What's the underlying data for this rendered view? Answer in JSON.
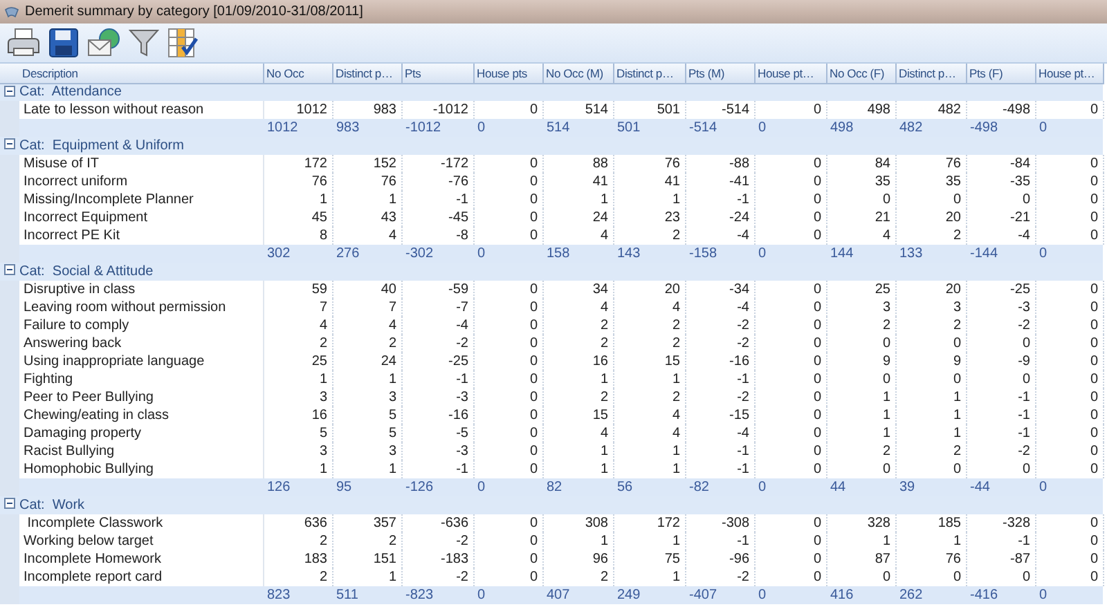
{
  "window": {
    "title": "Demerit summary by category [01/09/2010-31/08/2011]"
  },
  "table": {
    "columns": [
      "Description",
      "No Occ",
      "Distinct p…",
      "Pts",
      "House pts",
      "No Occ (M)",
      "Distinct p…",
      "Pts (M)",
      "House pt…",
      "No Occ (F)",
      "Distinct p…",
      "Pts (F)",
      "House pt…"
    ],
    "groups": [
      {
        "label": "Cat:  Attendance",
        "expanded": true,
        "rows": [
          {
            "description": "Late to lesson without reason",
            "values": [
              "1012",
              "983",
              "-1012",
              "0",
              "514",
              "501",
              "-514",
              "0",
              "498",
              "482",
              "-498",
              "0"
            ]
          }
        ],
        "totals": [
          "1012",
          "983",
          "-1012",
          "0",
          "514",
          "501",
          "-514",
          "0",
          "498",
          "482",
          "-498",
          "0"
        ]
      },
      {
        "label": "Cat:  Equipment & Uniform",
        "expanded": true,
        "rows": [
          {
            "description": "Misuse of IT",
            "values": [
              "172",
              "152",
              "-172",
              "0",
              "88",
              "76",
              "-88",
              "0",
              "84",
              "76",
              "-84",
              "0"
            ]
          },
          {
            "description": "Incorrect uniform",
            "values": [
              "76",
              "76",
              "-76",
              "0",
              "41",
              "41",
              "-41",
              "0",
              "35",
              "35",
              "-35",
              "0"
            ]
          },
          {
            "description": "Missing/Incomplete Planner",
            "values": [
              "1",
              "1",
              "-1",
              "0",
              "1",
              "1",
              "-1",
              "0",
              "0",
              "0",
              "0",
              "0"
            ]
          },
          {
            "description": "Incorrect Equipment",
            "values": [
              "45",
              "43",
              "-45",
              "0",
              "24",
              "23",
              "-24",
              "0",
              "21",
              "20",
              "-21",
              "0"
            ]
          },
          {
            "description": "Incorrect PE Kit",
            "values": [
              "8",
              "4",
              "-8",
              "0",
              "4",
              "2",
              "-4",
              "0",
              "4",
              "2",
              "-4",
              "0"
            ]
          }
        ],
        "totals": [
          "302",
          "276",
          "-302",
          "0",
          "158",
          "143",
          "-158",
          "0",
          "144",
          "133",
          "-144",
          "0"
        ]
      },
      {
        "label": "Cat:  Social & Attitude",
        "expanded": true,
        "rows": [
          {
            "description": "Disruptive in class",
            "values": [
              "59",
              "40",
              "-59",
              "0",
              "34",
              "20",
              "-34",
              "0",
              "25",
              "20",
              "-25",
              "0"
            ]
          },
          {
            "description": "Leaving room without permission",
            "values": [
              "7",
              "7",
              "-7",
              "0",
              "4",
              "4",
              "-4",
              "0",
              "3",
              "3",
              "-3",
              "0"
            ]
          },
          {
            "description": "Failure to comply",
            "values": [
              "4",
              "4",
              "-4",
              "0",
              "2",
              "2",
              "-2",
              "0",
              "2",
              "2",
              "-2",
              "0"
            ]
          },
          {
            "description": "Answering back",
            "values": [
              "2",
              "2",
              "-2",
              "0",
              "2",
              "2",
              "-2",
              "0",
              "0",
              "0",
              "0",
              "0"
            ]
          },
          {
            "description": "Using inappropriate language",
            "values": [
              "25",
              "24",
              "-25",
              "0",
              "16",
              "15",
              "-16",
              "0",
              "9",
              "9",
              "-9",
              "0"
            ]
          },
          {
            "description": "Fighting",
            "values": [
              "1",
              "1",
              "-1",
              "0",
              "1",
              "1",
              "-1",
              "0",
              "0",
              "0",
              "0",
              "0"
            ]
          },
          {
            "description": "Peer to Peer Bullying",
            "values": [
              "3",
              "3",
              "-3",
              "0",
              "2",
              "2",
              "-2",
              "0",
              "1",
              "1",
              "-1",
              "0"
            ]
          },
          {
            "description": "Chewing/eating in class",
            "values": [
              "16",
              "5",
              "-16",
              "0",
              "15",
              "4",
              "-15",
              "0",
              "1",
              "1",
              "-1",
              "0"
            ]
          },
          {
            "description": "Damaging property",
            "values": [
              "5",
              "5",
              "-5",
              "0",
              "4",
              "4",
              "-4",
              "0",
              "1",
              "1",
              "-1",
              "0"
            ]
          },
          {
            "description": "Racist Bullying",
            "values": [
              "3",
              "3",
              "-3",
              "0",
              "1",
              "1",
              "-1",
              "0",
              "2",
              "2",
              "-2",
              "0"
            ]
          },
          {
            "description": "Homophobic Bullying",
            "values": [
              "1",
              "1",
              "-1",
              "0",
              "1",
              "1",
              "-1",
              "0",
              "0",
              "0",
              "0",
              "0"
            ]
          }
        ],
        "totals": [
          "126",
          "95",
          "-126",
          "0",
          "82",
          "56",
          "-82",
          "0",
          "44",
          "39",
          "-44",
          "0"
        ]
      },
      {
        "label": "Cat:  Work",
        "expanded": true,
        "rows": [
          {
            "description": " Incomplete Classwork",
            "values": [
              "636",
              "357",
              "-636",
              "0",
              "308",
              "172",
              "-308",
              "0",
              "328",
              "185",
              "-328",
              "0"
            ]
          },
          {
            "description": "Working below target",
            "values": [
              "2",
              "2",
              "-2",
              "0",
              "1",
              "1",
              "-1",
              "0",
              "1",
              "1",
              "-1",
              "0"
            ]
          },
          {
            "description": "Incomplete Homework",
            "values": [
              "183",
              "151",
              "-183",
              "0",
              "96",
              "75",
              "-96",
              "0",
              "87",
              "76",
              "-87",
              "0"
            ]
          },
          {
            "description": "Incomplete report card",
            "values": [
              "2",
              "1",
              "-2",
              "0",
              "2",
              "1",
              "-2",
              "0",
              "0",
              "0",
              "0",
              "0"
            ]
          }
        ],
        "totals": [
          "823",
          "511",
          "-823",
          "0",
          "407",
          "249",
          "-407",
          "0",
          "416",
          "262",
          "-416",
          "0"
        ]
      }
    ]
  }
}
